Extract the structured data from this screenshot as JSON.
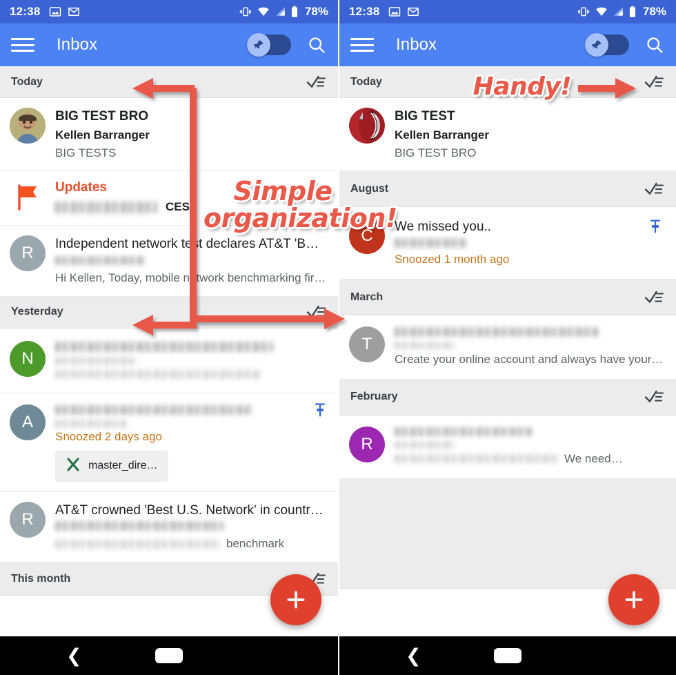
{
  "status_bar": {
    "time": "12:38",
    "battery_text": "78%",
    "icons": [
      "photos-icon",
      "gmail-icon",
      "vibrate-icon",
      "wifi-icon",
      "signal-icon",
      "battery-icon"
    ]
  },
  "app_bar": {
    "menu_icon": "hamburger-menu-icon",
    "title": "Inbox",
    "toggle_icon": "pin-toggle-icon",
    "search_icon": "search-icon"
  },
  "colors": {
    "status_bar": "#3B63D4",
    "app_bar": "#4D82F3",
    "accent_red": "#E0402E",
    "annotation": "#E8594A",
    "snooze": "#C5741A",
    "pin_blue": "#3367D6",
    "section_bg": "#ECECEC"
  },
  "annotations": [
    {
      "text": "Simple\norganization!",
      "line1": "Simple",
      "line2": "organization!"
    },
    {
      "text": "Handy!"
    }
  ],
  "left_phone": {
    "sections": [
      {
        "title": "Today",
        "sweep_icon": "done-all-sweep-icon",
        "rows": [
          {
            "avatar": {
              "type": "photo",
              "label": "",
              "color": "#8a9a5b"
            },
            "title": "BIG TEST BRO",
            "sub": "Kellen Barranger",
            "snippet": "BIG TESTS",
            "pinned": false
          },
          {
            "avatar": {
              "type": "flag",
              "label": "",
              "color": "#E8502D"
            },
            "title": "Updates",
            "title_color": "#E8502D",
            "sub_blurred": true,
            "sub_suffix": "CES",
            "pinned": false
          },
          {
            "avatar": {
              "type": "letter",
              "label": "R",
              "color": "#9AA7AD"
            },
            "title": "Independent network test declares AT&T 'B…",
            "sub_blurred": true,
            "snippet": "Hi Kellen, Today, mobile network benchmarking fir…",
            "pinned": false
          }
        ]
      },
      {
        "title": "Yesterday",
        "sweep_icon": "done-all-sweep-icon",
        "rows": [
          {
            "avatar": {
              "type": "letter",
              "label": "N",
              "color": "#4C9A2A"
            },
            "title_blurred": true,
            "sub_blurred": true,
            "snippet_blurred": true,
            "pinned": false
          },
          {
            "avatar": {
              "type": "letter",
              "label": "A",
              "color": "#6F8A96"
            },
            "title_blurred": true,
            "sub_blurred": true,
            "snoozed": "Snoozed 2 days ago",
            "attachment": {
              "icon": "excel-file-icon",
              "name": "master_dire…"
            },
            "pinned": true
          },
          {
            "avatar": {
              "type": "letter",
              "label": "R",
              "color": "#9AA7AD"
            },
            "title": "AT&T crowned 'Best U.S. Network' in countr…",
            "sub_blurred": true,
            "snippet_suffix": "benchmark",
            "pinned": false
          }
        ]
      },
      {
        "title": "This month",
        "sweep_icon": "done-all-sweep-icon",
        "rows": []
      }
    ],
    "fab": {
      "icon": "add-compose-icon"
    },
    "nav": {
      "back_icon": "back-icon",
      "home_icon": "home-pill-icon"
    }
  },
  "right_phone": {
    "sections": [
      {
        "title": "Today",
        "sweep_icon": "done-all-sweep-icon",
        "rows": [
          {
            "avatar": {
              "type": "logo",
              "label": "",
              "color": "#A81F27"
            },
            "title": "BIG TEST",
            "sub": "Kellen Barranger",
            "snippet": "BIG TEST BRO",
            "pinned": false
          }
        ]
      },
      {
        "title": "August",
        "sweep_icon": "done-all-sweep-icon",
        "rows": [
          {
            "avatar": {
              "type": "letter",
              "label": "C",
              "color": "#C0341B"
            },
            "title": "We missed you..",
            "sub_blurred": true,
            "snoozed": "Snoozed 1 month ago",
            "pinned": true
          }
        ]
      },
      {
        "title": "March",
        "sweep_icon": "done-all-sweep-icon",
        "rows": [
          {
            "avatar": {
              "type": "letter",
              "label": "T",
              "color": "#9E9E9E"
            },
            "title_blurred": true,
            "sub_blurred": true,
            "snippet": "Create your online account and always have your…",
            "pinned": false
          }
        ]
      },
      {
        "title": "February",
        "sweep_icon": "done-all-sweep-icon",
        "rows": [
          {
            "avatar": {
              "type": "letter",
              "label": "R",
              "color": "#9C27B0"
            },
            "title_blurred": true,
            "sub_blurred": true,
            "snippet_suffix": "We need…",
            "pinned": false
          }
        ]
      }
    ],
    "fab": {
      "icon": "add-compose-icon"
    },
    "nav": {
      "back_icon": "back-icon",
      "home_icon": "home-pill-icon"
    }
  }
}
